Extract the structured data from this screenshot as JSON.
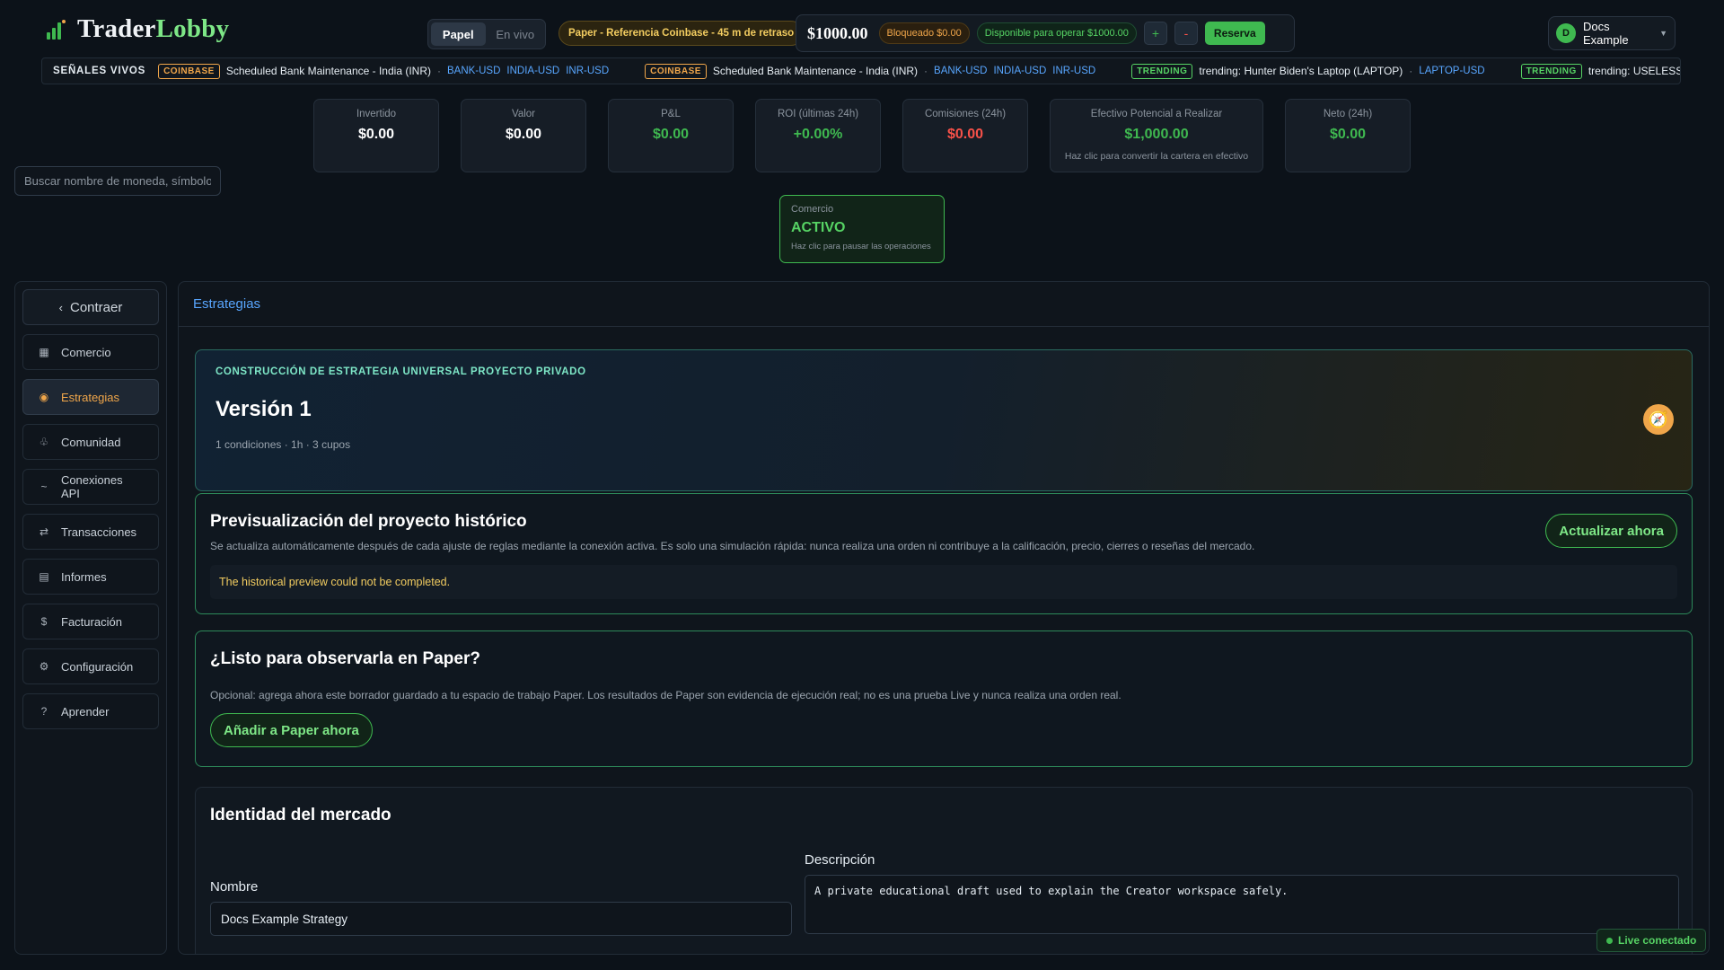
{
  "brand": {
    "name_part1": "Trader",
    "name_part2": "Lobby",
    "accent_color": "#7ee787"
  },
  "mode_toggle": {
    "paper_label": "Papel",
    "live_label": "En vivo",
    "selected": "Papel"
  },
  "paper_badge": "Paper - Referencia Coinbase - 45 m de retraso",
  "balance": {
    "amount": "$1000.00",
    "blocked": "Bloqueado $0.00",
    "available": "Disponible para operar $1000.00",
    "plus_label": "+",
    "minus_label": "-",
    "reserve_label": "Reserva"
  },
  "user": {
    "initial": "D",
    "name": "Docs Example"
  },
  "ticker": {
    "title": "SEÑALES VIVOS",
    "items": [
      {
        "tag": "COINBASE",
        "text": "Scheduled Bank Maintenance - India (INR)",
        "symbols": [
          "BANK-USD",
          "INDIA-USD",
          "INR-USD"
        ]
      },
      {
        "tag": "COINBASE",
        "text": "Scheduled Bank Maintenance - India (INR)",
        "symbols": [
          "BANK-USD",
          "INDIA-USD",
          "INR-USD"
        ]
      },
      {
        "tag": "TRENDING",
        "text": "trending: Hunter Biden's Laptop (LAPTOP)",
        "symbols": [
          "LAPTOP-USD"
        ]
      },
      {
        "tag": "TRENDING",
        "text": "trending: USELESS STONK (STON",
        "symbols": []
      }
    ]
  },
  "stats": [
    {
      "label": "Invertido",
      "value": "$0.00",
      "color": "white"
    },
    {
      "label": "Valor",
      "value": "$0.00",
      "color": "white"
    },
    {
      "label": "P&L",
      "value": "$0.00",
      "color": "green"
    },
    {
      "label": "ROI (últimas 24h)",
      "value": "+0.00%",
      "color": "green"
    },
    {
      "label": "Comisiones (24h)",
      "value": "$0.00",
      "color": "red"
    },
    {
      "label": "Efectivo Potencial a Realizar",
      "value": "$1,000.00",
      "color": "green",
      "sub": "Haz clic para convertir la cartera en efectivo"
    },
    {
      "label": "Neto (24h)",
      "value": "$0.00",
      "color": "green"
    }
  ],
  "search": {
    "placeholder": "Buscar nombre de moneda, símbolo"
  },
  "trading": {
    "label": "Comercio",
    "status": "ACTIVO",
    "hint": "Haz clic para pausar las operaciones"
  },
  "sidebar": {
    "collapse_label": "Contraer",
    "items": [
      {
        "label": "Comercio",
        "icon": "grid-icon"
      },
      {
        "label": "Estrategias",
        "icon": "strategy-icon",
        "active": true
      },
      {
        "label": "Comunidad",
        "icon": "community-icon"
      },
      {
        "label": "Conexiones API",
        "icon": "api-icon"
      },
      {
        "label": "Transacciones",
        "icon": "transfer-icon"
      },
      {
        "label": "Informes",
        "icon": "report-icon"
      },
      {
        "label": "Facturación",
        "icon": "dollar-icon"
      },
      {
        "label": "Configuración",
        "icon": "gear-icon"
      },
      {
        "label": "Aprender",
        "icon": "question-icon"
      }
    ]
  },
  "main": {
    "breadcrumb": "Estrategias",
    "hero": {
      "kicker": "CONSTRUCCIÓN DE ESTRATEGIA UNIVERSAL PROYECTO PRIVADO",
      "title": "Versión 1",
      "meta": "1 condiciones · 1h · 3 cupos"
    },
    "preview": {
      "title": "Previsualización del proyecto histórico",
      "description": "Se actualiza automáticamente después de cada ajuste de reglas mediante la conexión activa. Es solo una simulación rápida: nunca realiza una orden ni contribuye a la calificación, precio, cierres o reseñas del mercado.",
      "error": "The historical preview could not be completed.",
      "refresh_label": "Actualizar ahora"
    },
    "paper_cta": {
      "title": "¿Listo para observarla en Paper?",
      "description": "Opcional: agrega ahora este borrador guardado a tu espacio de trabajo Paper. Los resultados de Paper son evidencia de ejecución real; no es una prueba Live y nunca realiza una orden real.",
      "button_label": "Añadir a Paper ahora"
    },
    "identity": {
      "title": "Identidad del mercado",
      "name_label": "Nombre",
      "name_value": "Docs Example Strategy",
      "description_label": "Descripción",
      "description_value": "A private educational draft used to explain the Creator workspace safely."
    }
  },
  "live_status": "Live conectado"
}
